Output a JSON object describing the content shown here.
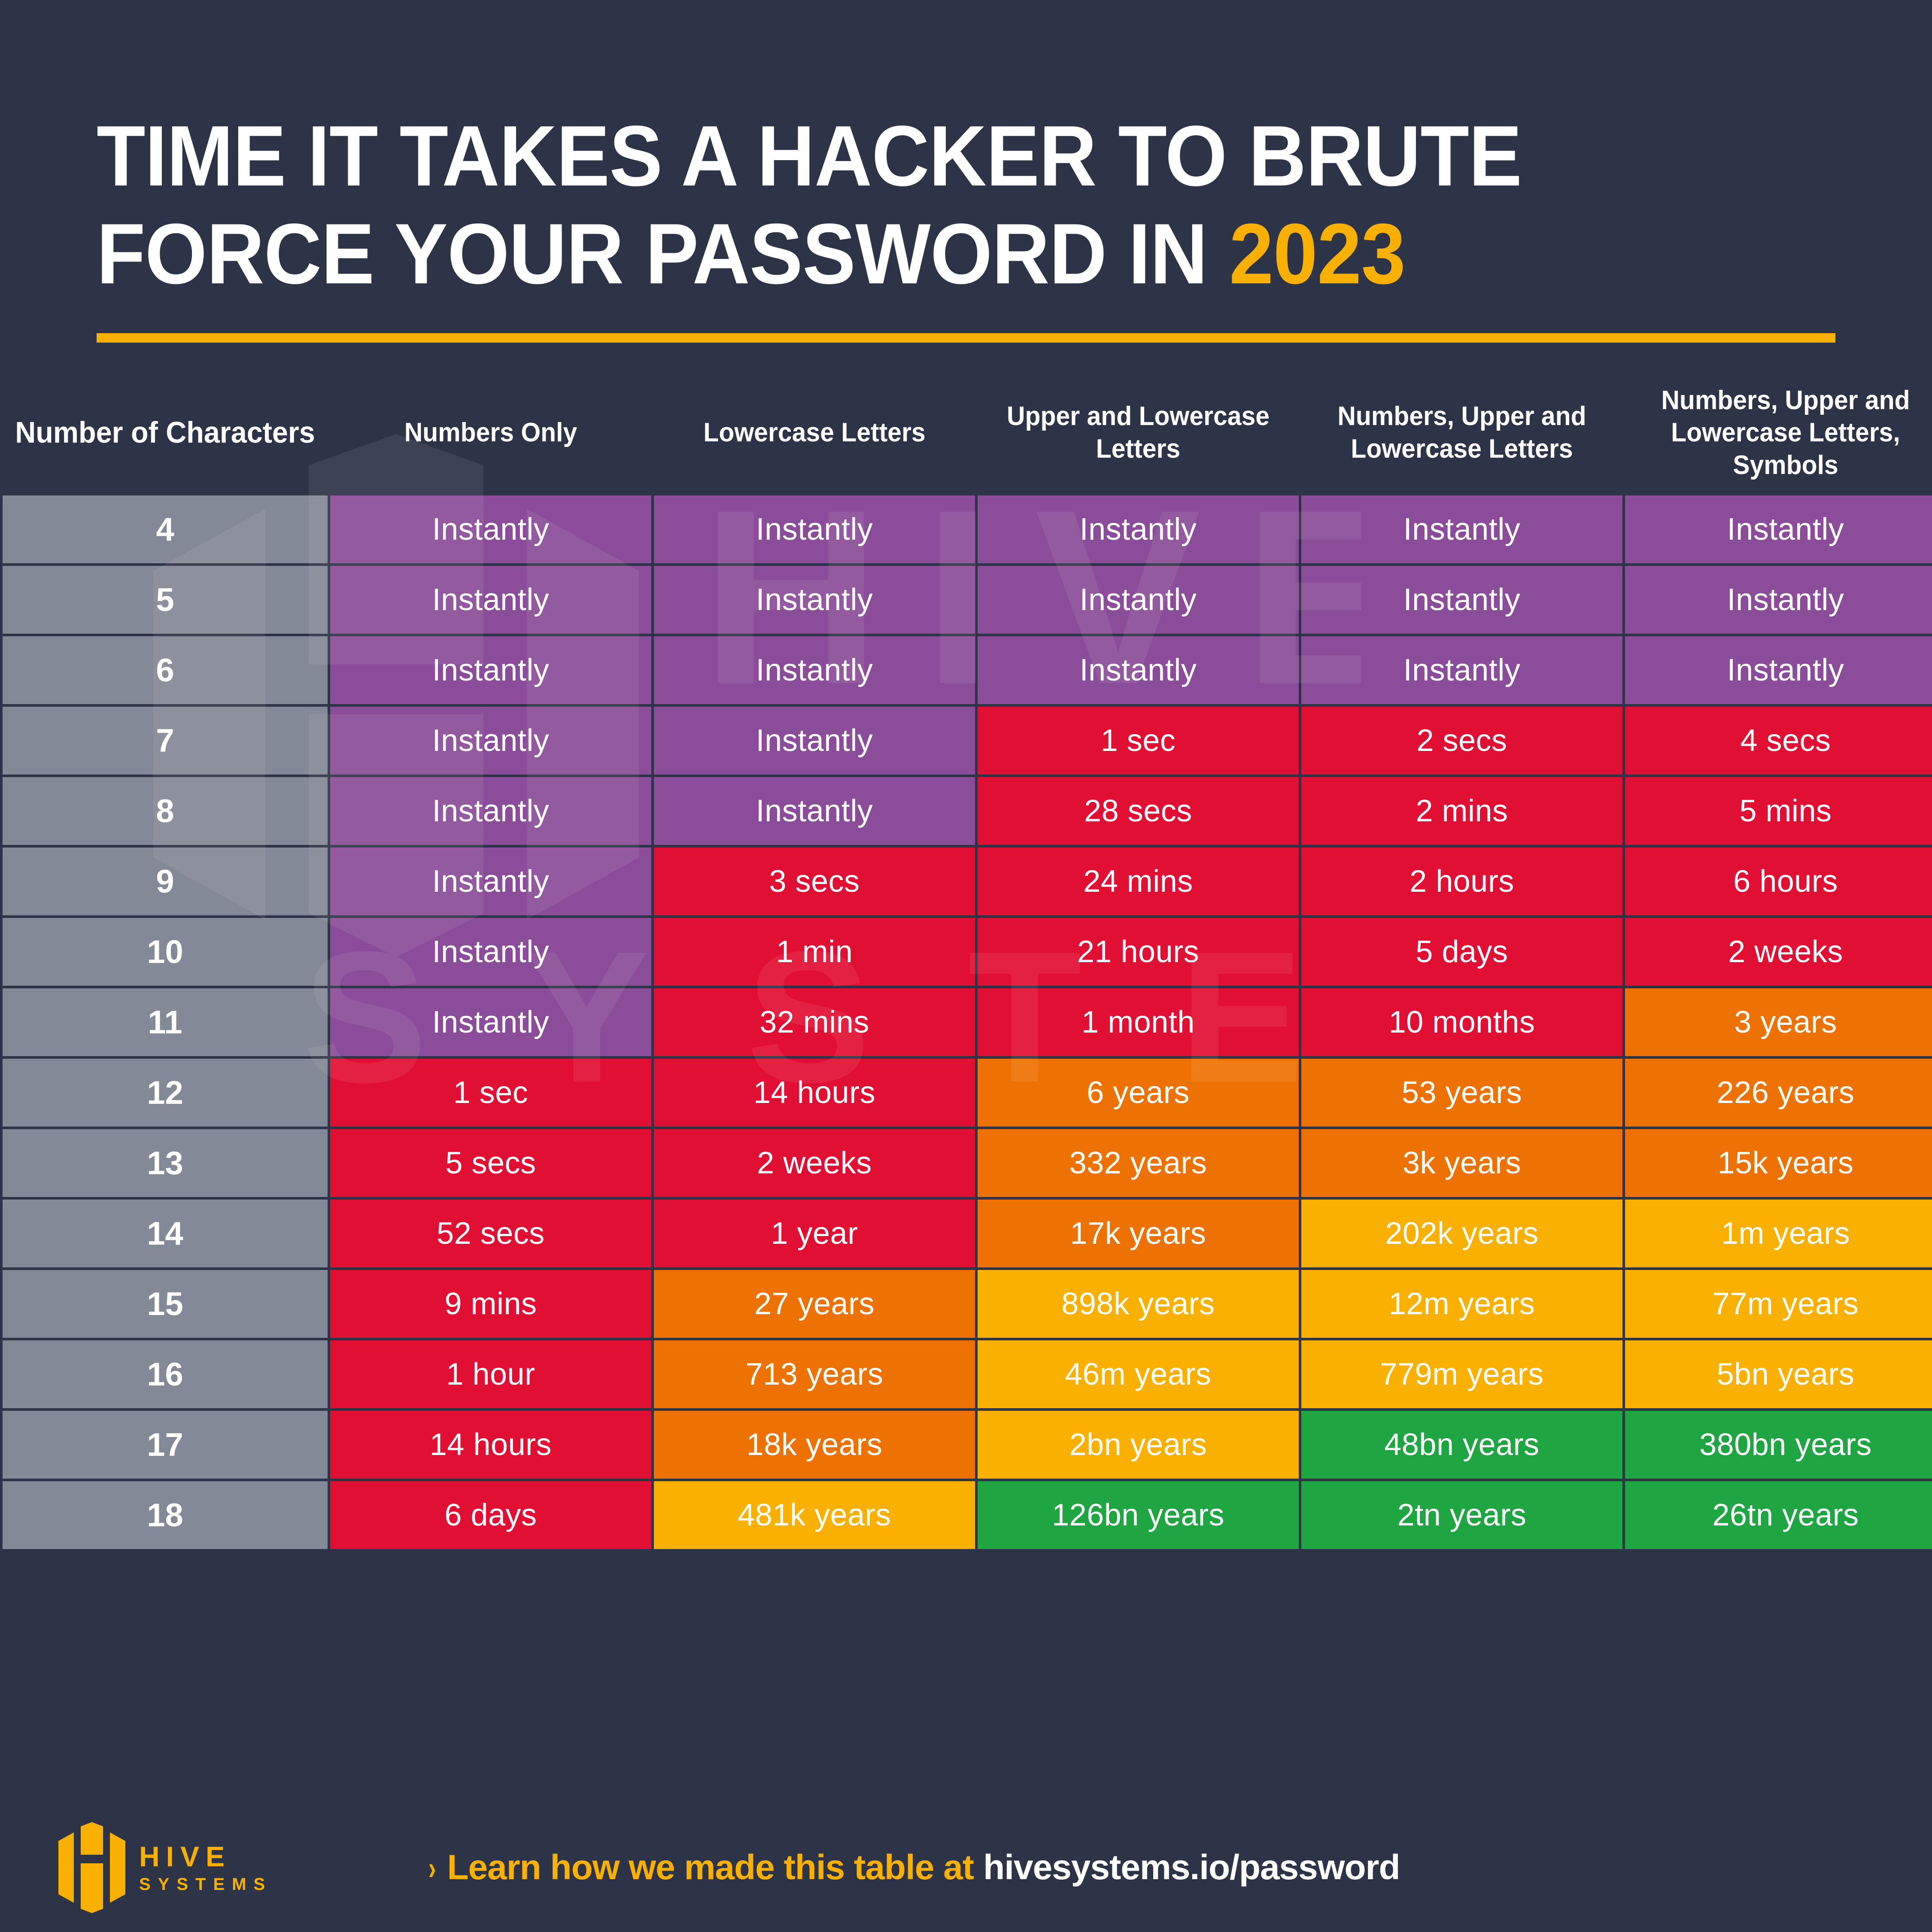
{
  "title": {
    "line1": "TIME IT TAKES A HACKER TO BRUTE",
    "line2": "FORCE YOUR PASSWORD IN ",
    "year": "2023"
  },
  "colors": {
    "background": "#2e3447",
    "accent": "#f9b000",
    "rowhead": "#838996",
    "instant": "#8b4d99",
    "fast": "#e20f34",
    "medium": "#ee7203",
    "slow": "#f9b000",
    "safe": "#1fa542",
    "text": "#ffffff"
  },
  "table": {
    "headers": [
      "Number of Characters",
      "Numbers Only",
      "Lowercase Letters",
      "Upper and Lowercase Letters",
      "Numbers, Upper and Lowercase Letters",
      "Numbers, Upper and Lowercase Letters, Symbols"
    ],
    "rows": [
      {
        "chars": "4",
        "cells": [
          {
            "v": "Instantly",
            "c": "c-purple"
          },
          {
            "v": "Instantly",
            "c": "c-purple"
          },
          {
            "v": "Instantly",
            "c": "c-purple"
          },
          {
            "v": "Instantly",
            "c": "c-purple"
          },
          {
            "v": "Instantly",
            "c": "c-purple"
          }
        ]
      },
      {
        "chars": "5",
        "cells": [
          {
            "v": "Instantly",
            "c": "c-purple"
          },
          {
            "v": "Instantly",
            "c": "c-purple"
          },
          {
            "v": "Instantly",
            "c": "c-purple"
          },
          {
            "v": "Instantly",
            "c": "c-purple"
          },
          {
            "v": "Instantly",
            "c": "c-purple"
          }
        ]
      },
      {
        "chars": "6",
        "cells": [
          {
            "v": "Instantly",
            "c": "c-purple"
          },
          {
            "v": "Instantly",
            "c": "c-purple"
          },
          {
            "v": "Instantly",
            "c": "c-purple"
          },
          {
            "v": "Instantly",
            "c": "c-purple"
          },
          {
            "v": "Instantly",
            "c": "c-purple"
          }
        ]
      },
      {
        "chars": "7",
        "cells": [
          {
            "v": "Instantly",
            "c": "c-purple"
          },
          {
            "v": "Instantly",
            "c": "c-purple"
          },
          {
            "v": "1 sec",
            "c": "c-red"
          },
          {
            "v": "2 secs",
            "c": "c-red"
          },
          {
            "v": "4 secs",
            "c": "c-red"
          }
        ]
      },
      {
        "chars": "8",
        "cells": [
          {
            "v": "Instantly",
            "c": "c-purple"
          },
          {
            "v": "Instantly",
            "c": "c-purple"
          },
          {
            "v": "28 secs",
            "c": "c-red"
          },
          {
            "v": "2 mins",
            "c": "c-red"
          },
          {
            "v": "5 mins",
            "c": "c-red"
          }
        ]
      },
      {
        "chars": "9",
        "cells": [
          {
            "v": "Instantly",
            "c": "c-purple"
          },
          {
            "v": "3 secs",
            "c": "c-red"
          },
          {
            "v": "24 mins",
            "c": "c-red"
          },
          {
            "v": "2 hours",
            "c": "c-red"
          },
          {
            "v": "6 hours",
            "c": "c-red"
          }
        ]
      },
      {
        "chars": "10",
        "cells": [
          {
            "v": "Instantly",
            "c": "c-purple"
          },
          {
            "v": "1 min",
            "c": "c-red"
          },
          {
            "v": "21 hours",
            "c": "c-red"
          },
          {
            "v": "5 days",
            "c": "c-red"
          },
          {
            "v": "2 weeks",
            "c": "c-red"
          }
        ]
      },
      {
        "chars": "11",
        "cells": [
          {
            "v": "Instantly",
            "c": "c-purple"
          },
          {
            "v": "32 mins",
            "c": "c-red"
          },
          {
            "v": "1 month",
            "c": "c-red"
          },
          {
            "v": "10 months",
            "c": "c-red"
          },
          {
            "v": "3 years",
            "c": "c-orange"
          }
        ]
      },
      {
        "chars": "12",
        "cells": [
          {
            "v": "1 sec",
            "c": "c-red"
          },
          {
            "v": "14 hours",
            "c": "c-red"
          },
          {
            "v": "6 years",
            "c": "c-orange"
          },
          {
            "v": "53 years",
            "c": "c-orange"
          },
          {
            "v": "226 years",
            "c": "c-orange"
          }
        ]
      },
      {
        "chars": "13",
        "cells": [
          {
            "v": "5 secs",
            "c": "c-red"
          },
          {
            "v": "2 weeks",
            "c": "c-red"
          },
          {
            "v": "332 years",
            "c": "c-orange"
          },
          {
            "v": "3k years",
            "c": "c-orange"
          },
          {
            "v": "15k years",
            "c": "c-orange"
          }
        ]
      },
      {
        "chars": "14",
        "cells": [
          {
            "v": "52 secs",
            "c": "c-red"
          },
          {
            "v": "1 year",
            "c": "c-red"
          },
          {
            "v": "17k years",
            "c": "c-orange"
          },
          {
            "v": "202k years",
            "c": "c-yellow"
          },
          {
            "v": "1m years",
            "c": "c-yellow"
          }
        ]
      },
      {
        "chars": "15",
        "cells": [
          {
            "v": "9 mins",
            "c": "c-red"
          },
          {
            "v": "27 years",
            "c": "c-orange"
          },
          {
            "v": "898k years",
            "c": "c-yellow"
          },
          {
            "v": "12m years",
            "c": "c-yellow"
          },
          {
            "v": "77m years",
            "c": "c-yellow"
          }
        ]
      },
      {
        "chars": "16",
        "cells": [
          {
            "v": "1 hour",
            "c": "c-red"
          },
          {
            "v": "713 years",
            "c": "c-orange"
          },
          {
            "v": "46m years",
            "c": "c-yellow"
          },
          {
            "v": "779m years",
            "c": "c-yellow"
          },
          {
            "v": "5bn years",
            "c": "c-yellow"
          }
        ]
      },
      {
        "chars": "17",
        "cells": [
          {
            "v": "14 hours",
            "c": "c-red"
          },
          {
            "v": "18k years",
            "c": "c-orange"
          },
          {
            "v": "2bn years",
            "c": "c-yellow"
          },
          {
            "v": "48bn years",
            "c": "c-green"
          },
          {
            "v": "380bn years",
            "c": "c-green"
          }
        ]
      },
      {
        "chars": "18",
        "cells": [
          {
            "v": "6 days",
            "c": "c-red"
          },
          {
            "v": "481k years",
            "c": "c-yellow"
          },
          {
            "v": "126bn years",
            "c": "c-green"
          },
          {
            "v": "2tn years",
            "c": "c-green"
          },
          {
            "v": "26tn years",
            "c": "c-green"
          }
        ]
      }
    ]
  },
  "watermark": {
    "hive": "HIVE",
    "systems": "SYSTEMS"
  },
  "footer": {
    "logo_hive": "HIVE",
    "logo_systems": "SYSTEMS",
    "chevron": "›",
    "cta": "Learn how we made this table at",
    "url": "hivesystems.io/password"
  }
}
